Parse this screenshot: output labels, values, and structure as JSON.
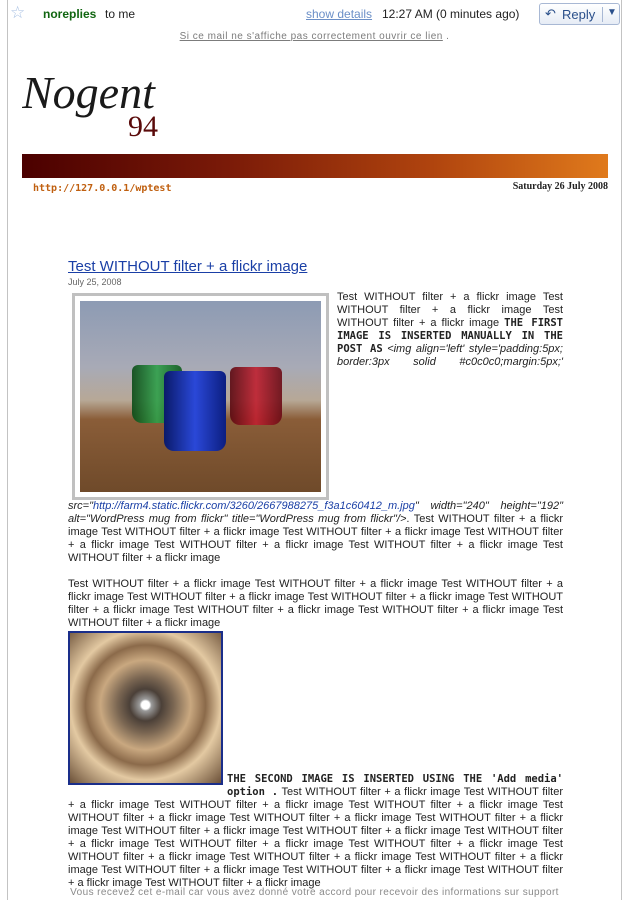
{
  "header": {
    "sender": "noreplies",
    "to": "to me",
    "show_details": "show details",
    "time": "12:27 AM (0 minutes ago)",
    "reply": "Reply"
  },
  "notice": {
    "text": "Si ce mail ne s'affiche pas correctement ouvrir ce lien",
    "suffix": "."
  },
  "logo": {
    "word": "Nogent",
    "number": "94"
  },
  "site": {
    "url": "http://127.0.0.1/wptest",
    "date": "Saturday 26 July 2008"
  },
  "post": {
    "title": "Test WITHOUT filter + a flickr image",
    "date": "July 25, 2008",
    "p1_intro": "Test WITHOUT filter + a flickr image Test WITHOUT filter + a flickr image Test WITHOUT filter + a flickr image",
    "p1_bold": "THE FIRST IMAGE IS INSERTED MANUALLY IN THE POST AS",
    "p1_code1": "<img align='left' style='padding:5px; border:3px solid #c0c0c0;margin:5px;' src=\"",
    "p1_link": "http://farm4.static.flickr.com/3260/2667988275_f3a1c60412_m.jpg",
    "p1_code2": "\" width=\"240\" height=\"192\" alt=\"WordPress mug from flickr\" title=\"WordPress mug from flickr\"/>",
    "p1_rest": ". Test WITHOUT filter + a flickr image Test WITHOUT filter + a flickr image Test WITHOUT filter + a flickr image Test WITHOUT filter + a flickr image Test WITHOUT filter + a flickr image Test WITHOUT filter + a flickr image Test WITHOUT filter + a flickr image",
    "p2_intro": "Test WITHOUT filter + a flickr image Test WITHOUT filter + a flickr image Test WITHOUT filter + a flickr image Test WITHOUT filter + a flickr image Test WITHOUT filter + a flickr image Test WITHOUT filter + a flickr image Test WITHOUT filter + a flickr image Test WITHOUT filter + a flickr image Test WITHOUT filter + a flickr image",
    "p2_bold": "THE SECOND IMAGE IS INSERTED USING THE 'Add media' option .",
    "p2_rest": " Test WITHOUT filter + a flickr image Test WITHOUT filter + a flickr image Test WITHOUT filter + a flickr image Test WITHOUT filter + a flickr image Test WITHOUT filter + a flickr image Test WITHOUT filter + a flickr image Test WITHOUT filter + a flickr image Test WITHOUT filter + a flickr image Test WITHOUT filter + a flickr image Test WITHOUT filter + a flickr image Test WITHOUT filter + a flickr image Test WITHOUT filter + a flickr image Test WITHOUT filter + a flickr image Test WITHOUT filter + a flickr image Test WITHOUT filter + a flickr image Test WITHOUT filter + a flickr image Test WITHOUT filter + a flickr image Test WITHOUT filter + a flickr image Test WITHOUT filter + a flickr image"
  },
  "footer": {
    "text": "Vous recevez cet e-mail car vous avez donné votre accord pour recevoir des informations sur support"
  },
  "colors": {
    "sender": "#116611",
    "link": "#1a3fa6",
    "banner_dark": "#4b0000",
    "banner_light": "#e07a1c",
    "url": "#c06010"
  },
  "icons": {
    "star": "star-icon",
    "reply": "reply-arrow-icon",
    "dropdown": "chevron-down-icon"
  }
}
